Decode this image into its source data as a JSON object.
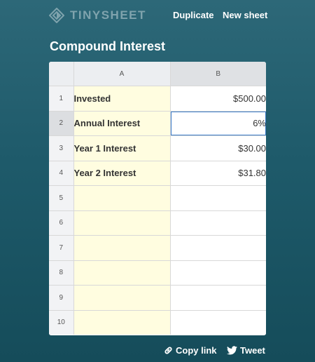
{
  "app": {
    "name": "TINYSHEET"
  },
  "nav": {
    "duplicate": "Duplicate",
    "new_sheet": "New sheet"
  },
  "sheet": {
    "title": "Compound Interest",
    "columns": [
      "A",
      "B"
    ],
    "selected_cell": "B2",
    "rows": [
      {
        "num": "1",
        "a": "Invested",
        "b": "$500.00"
      },
      {
        "num": "2",
        "a": "Annual Interest",
        "b": "6%"
      },
      {
        "num": "3",
        "a": "Year 1 Interest",
        "b": "$30.00"
      },
      {
        "num": "4",
        "a": "Year 2 Interest",
        "b": "$31.80"
      },
      {
        "num": "5",
        "a": "",
        "b": ""
      },
      {
        "num": "6",
        "a": "",
        "b": ""
      },
      {
        "num": "7",
        "a": "",
        "b": ""
      },
      {
        "num": "8",
        "a": "",
        "b": ""
      },
      {
        "num": "9",
        "a": "",
        "b": ""
      },
      {
        "num": "10",
        "a": "",
        "b": ""
      }
    ]
  },
  "footer": {
    "copy_link": "Copy link",
    "tweet": "Tweet"
  },
  "icons": {
    "logo": "logo-icon",
    "copy_link": "link-icon",
    "tweet": "twitter-bird-icon"
  },
  "colors": {
    "label_column_fill": "#fffde0",
    "selection_border": "#3a7bc8",
    "logo_color": "#7fa3ad"
  }
}
